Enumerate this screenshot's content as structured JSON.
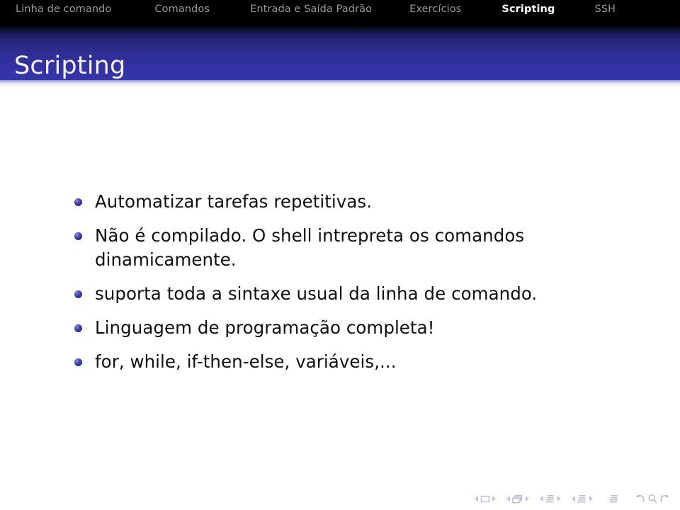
{
  "navbar": {
    "items": [
      {
        "label": "Linha de comando",
        "active": false
      },
      {
        "label": "Comandos",
        "active": false
      },
      {
        "label": "Entrada e Saída Padrão",
        "active": false
      },
      {
        "label": "Exercícios",
        "active": false
      },
      {
        "label": "Scripting",
        "active": true
      },
      {
        "label": "SSH",
        "active": false
      }
    ],
    "background_color": "#000000",
    "inactive_color": "#9a9a9a",
    "active_color": "#ffffff"
  },
  "frame": {
    "title": "Scripting",
    "title_bar_color_top": "#050510",
    "title_bar_color_bottom": "#3535ac",
    "title_text_color": "#f2f2f7"
  },
  "content": {
    "bullets": [
      {
        "text": "Automatizar tarefas repetitivas."
      },
      {
        "text": "Não é compilado. O shell intrepreta os comandos dinamicamente."
      },
      {
        "text": "suporta toda a sintaxe usual da linha de comando."
      },
      {
        "text": "Linguagem de programação completa!"
      },
      {
        "text": "for, while, if-then-else, variáveis,..."
      }
    ],
    "bullet_color": "#2b2b93",
    "text_color": "#101010"
  },
  "navigation_symbols": {
    "color": "#b9b9cf",
    "groups": [
      {
        "name": "slide-navigation",
        "icon": "slide-icon",
        "has_prev": true,
        "has_next": true
      },
      {
        "name": "frame-navigation",
        "icon": "frames-icon",
        "has_prev": true,
        "has_next": true
      },
      {
        "name": "subsection-navigation",
        "icon": "subsection-icon",
        "has_prev": true,
        "has_next": true
      },
      {
        "name": "section-navigation",
        "icon": "section-icon",
        "has_prev": true,
        "has_next": true
      },
      {
        "name": "presentation-navigation",
        "icon": "document-icon",
        "has_prev": false,
        "has_next": false
      }
    ],
    "utility": [
      {
        "name": "back-button",
        "icon": "undo-arrow-icon"
      },
      {
        "name": "find-button",
        "icon": "magnifier-icon"
      },
      {
        "name": "forward-button",
        "icon": "redo-arrow-icon"
      }
    ]
  }
}
